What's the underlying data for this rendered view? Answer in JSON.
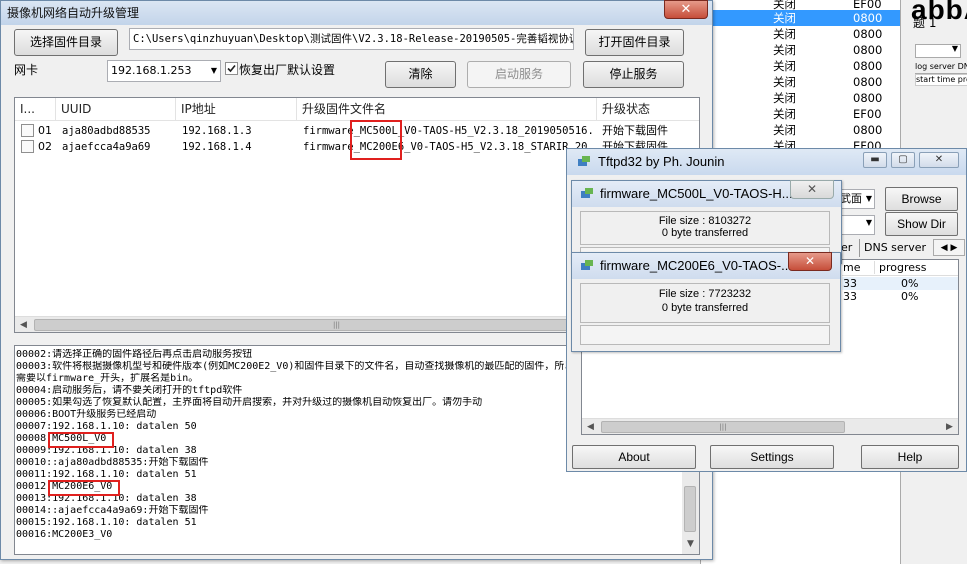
{
  "background": {
    "list_rows": [
      {
        "status": "关闭",
        "code": "EF00"
      },
      {
        "status": "关闭",
        "code": "0800"
      },
      {
        "status": "关闭",
        "code": "0800"
      },
      {
        "status": "关闭",
        "code": "0800"
      },
      {
        "status": "关闭",
        "code": "0800"
      },
      {
        "status": "关闭",
        "code": "0800"
      },
      {
        "status": "关闭",
        "code": "0800"
      },
      {
        "status": "关闭",
        "code": "EF00"
      },
      {
        "status": "关闭",
        "code": "0800"
      },
      {
        "status": "关闭",
        "code": "EF00"
      }
    ],
    "right_big_text": "abbA",
    "right_label": "题 1",
    "right_tabs": [
      "log server",
      "DNS s"
    ],
    "right_start_time": "start time",
    "right_prog": "prog"
  },
  "main_window": {
    "title": "摄像机网络自动升级管理",
    "close_glyph": "✕",
    "select_dir_button": "选择固件目录",
    "firmware_path": "C:\\Users\\qinzhuyuan\\Desktop\\测试固件\\V2.3.18-Release-20190505-完善韬视协议",
    "open_dir_button": "打开固件目录",
    "nic_label": "网卡",
    "nic_value": "192.168.1.253",
    "restore_checkbox_label": "恢复出厂默认设置",
    "restore_checked": true,
    "clear_button": "清除",
    "start_service_button": "启动服务",
    "stop_service_button": "停止服务",
    "table": {
      "headers": [
        "I...",
        "UUID",
        "IP地址",
        "升级固件文件名",
        "升级状态"
      ],
      "rows": [
        {
          "index": "01",
          "uuid": "aja80adbd88535",
          "ip": "192.168.1.3",
          "firmware": "firmware_MC500L_V0-TAOS-H5_V2.3.18_2019050516...",
          "status": "开始下载固件"
        },
        {
          "index": "02",
          "uuid": "ajaefcca4a9a69",
          "ip": "192.168.1.4",
          "firmware": "firmware_MC200E6_V0-TAOS-H5_V2.3.18_STARIR_20...",
          "status": "开始下载固件"
        }
      ]
    },
    "log_lines": [
      "00002:请选择正确的固件路径后再点击启动服务按钮",
      "00003:软件将根据摄像机型号和硬件版本(例如MC200E2_V0)和固件目录下的文件名，自动查找摄像机的最匹配的固件，所以固件名",
      "需要以firmware_开头，扩展名是bin。",
      "00004:启动服务后，请不要关闭打开的tftpd软件",
      "00005:如果勾选了恢复默认配置，主界面将自动开启搜索，并对升级过的摄像机自动恢复出厂。请勿手动",
      "00006:BOOT升级服务已经启动",
      "00007:192.168.1.10: datalen 50",
      "00008:MC500L_V0",
      "00009:192.168.1.10: datalen 38",
      "00010::aja80adbd88535:开始下载固件",
      "00011:192.168.1.10: datalen 51",
      "00012:MC200E6_V0",
      "00013:192.168.1.10: datalen 38",
      "00014::ajaefcca4a9a69:开始下载固件",
      "00015:192.168.1.10: datalen 51",
      "00016:MC200E3_V0"
    ]
  },
  "tftpd": {
    "title": "Tftpd32 by Ph. Jounin",
    "minimize_glyph": "▬",
    "maximize_glyph": "▢",
    "close_glyph": "✕",
    "browse_button": "Browse",
    "show_dir_button": "Show Dir",
    "tabs": [
      "er",
      "DNS server"
    ],
    "columns": [
      "me",
      "progress"
    ],
    "rows": [
      {
        "time": "33",
        "progress": "0%"
      },
      {
        "time": "33",
        "progress": "0%"
      }
    ],
    "about_button": "About",
    "settings_button": "Settings",
    "help_button": "Help",
    "combo_text": "武面"
  },
  "popups": [
    {
      "title": "firmware_MC500L_V0-TAOS-H...",
      "file_size": "File size : 8103272",
      "transferred": "0 byte transferred",
      "progress": 0
    },
    {
      "title": "firmware_MC200E6_V0-TAOS-...",
      "file_size": "File size : 7723232",
      "transferred": "0 byte transferred",
      "progress": 0
    }
  ],
  "colors": {
    "selected_row": "#3399ff",
    "highlight_box": "#e0201e",
    "progress_fill": "#5ab552"
  }
}
